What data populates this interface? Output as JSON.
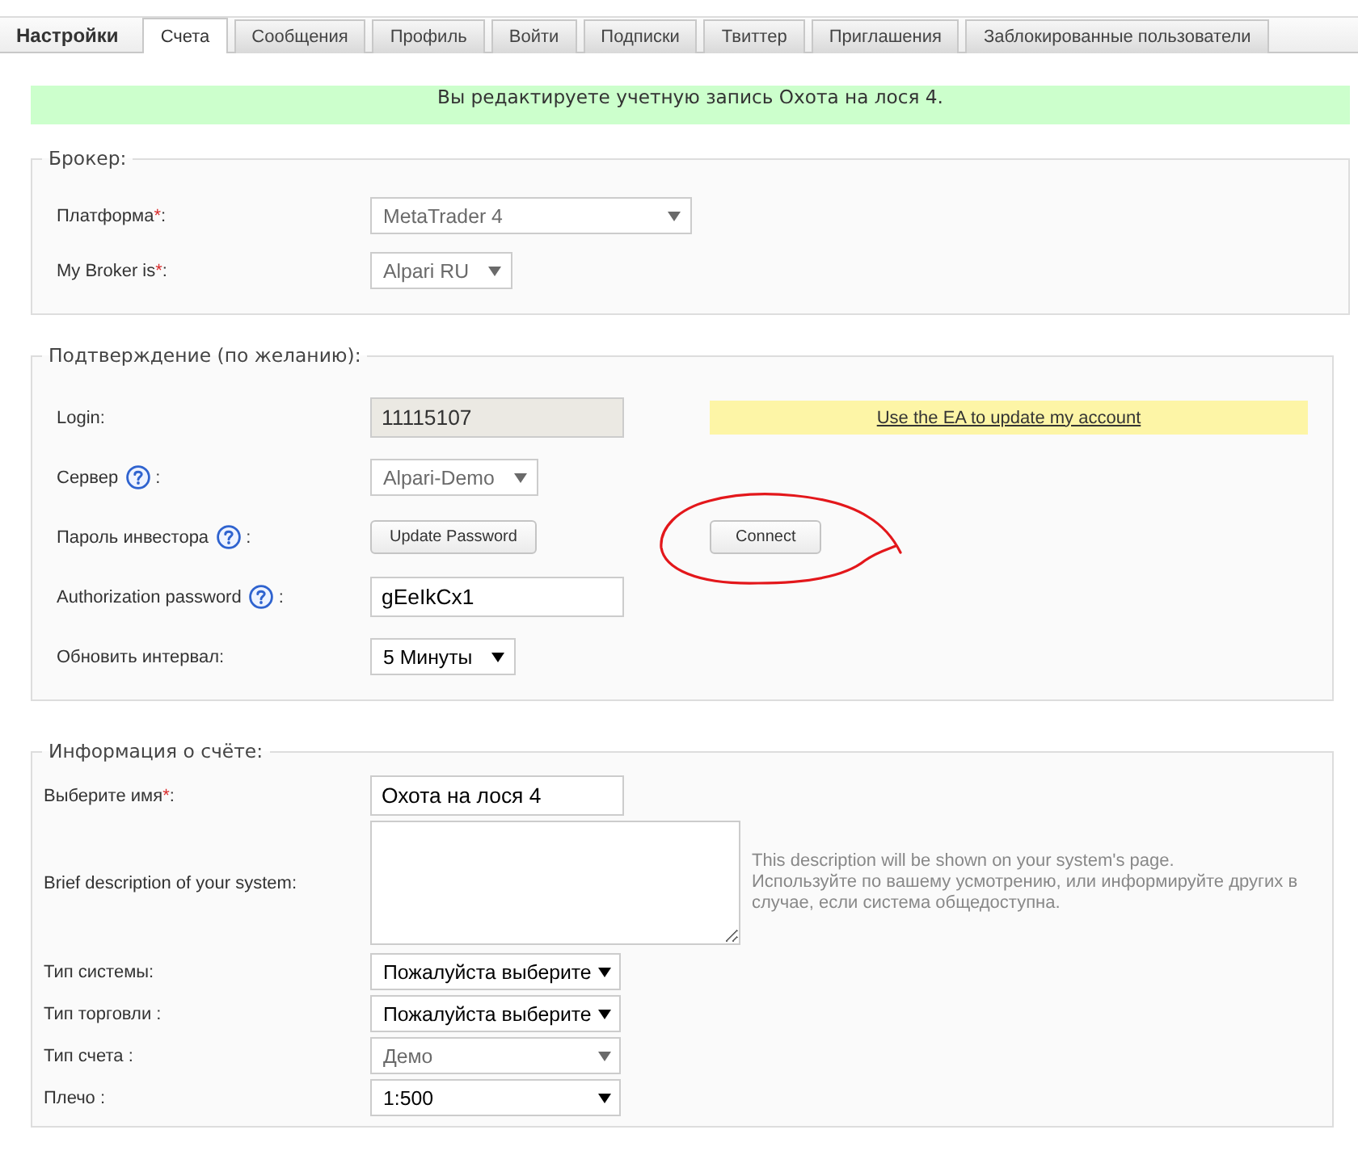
{
  "page_title": "Настройки",
  "tabs": [
    {
      "label": "Счета",
      "selected": true
    },
    {
      "label": "Сообщения",
      "selected": false
    },
    {
      "label": "Профиль",
      "selected": false
    },
    {
      "label": "Войти",
      "selected": false
    },
    {
      "label": "Подписки",
      "selected": false
    },
    {
      "label": "Твиттер",
      "selected": false
    },
    {
      "label": "Приглашения",
      "selected": false
    },
    {
      "label": "Заблокированные пользователи",
      "selected": false
    }
  ],
  "notice": "Вы редактируете учетную запись Охота на лося 4.",
  "sections": [
    {
      "legend": "Брокер:",
      "fields": [
        {
          "kind": "select",
          "label": "Платформа",
          "required_mark": "*",
          "suffix": ":",
          "value": "MetaTrader 4",
          "disabled": true
        },
        {
          "kind": "select",
          "label": "My Broker is",
          "required_mark": "*",
          "suffix": ":",
          "value": "Alpari RU",
          "disabled": true
        }
      ]
    },
    {
      "legend": "Подтверждение (по желанию):",
      "fields": [
        {
          "kind": "input",
          "label": "Login:",
          "value": "11115107",
          "readonly": true,
          "aside": {
            "kind": "link",
            "text": "Use the EA to update my account"
          }
        },
        {
          "kind": "select",
          "label": "Сервер",
          "help": true,
          "suffix": ":",
          "value": "Alpari-Demo",
          "disabled": true
        },
        {
          "kind": "button",
          "label": "Пароль инвестора",
          "help": true,
          "suffix": ":",
          "value": "Update Password",
          "aside": {
            "kind": "button",
            "text": "Connect",
            "circled": true
          }
        },
        {
          "kind": "input",
          "label": "Authorization password",
          "help": true,
          "suffix": ":",
          "value": "gEeIkCx1",
          "readonly": false
        },
        {
          "kind": "select",
          "label": "Обновить интервал:",
          "value": "5 Минуты",
          "disabled": false
        }
      ]
    },
    {
      "legend": "Информация о счёте:",
      "fields": [
        {
          "kind": "input",
          "label": "Выберите имя",
          "required_mark": "*",
          "suffix": ":",
          "value": "Охота на лося 4",
          "readonly": false
        },
        {
          "kind": "textarea",
          "label": "Brief description of your system:",
          "hint": [
            "This description will be shown on your system's page.",
            "Используйте по вашему усмотрению, или информируйте других в случае, если система общедоступна."
          ]
        },
        {
          "kind": "select",
          "label": "Тип системы:",
          "value": "Пожалуйста выберите",
          "disabled": false
        },
        {
          "kind": "select",
          "label": "Тип торговли :",
          "value": "Пожалуйста выберите",
          "disabled": false
        },
        {
          "kind": "select",
          "label": "Тип счета :",
          "value": "Демо",
          "disabled": true
        },
        {
          "kind": "select",
          "label": "Плечо :",
          "value": "1:500",
          "disabled": false
        }
      ]
    }
  ]
}
